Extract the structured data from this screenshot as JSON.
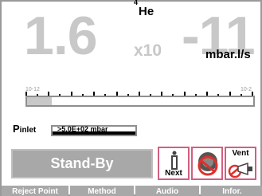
{
  "gas": {
    "isotope": "4",
    "element": "He"
  },
  "leak_rate": {
    "mantissa": "1.6",
    "multiplier": "x10",
    "exponent": "-11",
    "unit": "mbar.l/s"
  },
  "scale": {
    "low_base": "10",
    "low_exp": "-12",
    "high_base": "10",
    "high_exp": "-2",
    "level_fraction": 0.11
  },
  "inlet": {
    "label": "P",
    "sub": "inlet",
    "value": ">5.0E+02 mbar"
  },
  "status": {
    "text": "Stand-By"
  },
  "function_buttons": {
    "next_label": "Next",
    "vent_label": "Vent"
  },
  "tabs": [
    "Reject Point",
    "Method",
    "Audio",
    "Infor."
  ],
  "icons": {
    "next": "info-i-icon",
    "no_interference": "no-interference-icon",
    "vent": "vent-valve-icon"
  }
}
